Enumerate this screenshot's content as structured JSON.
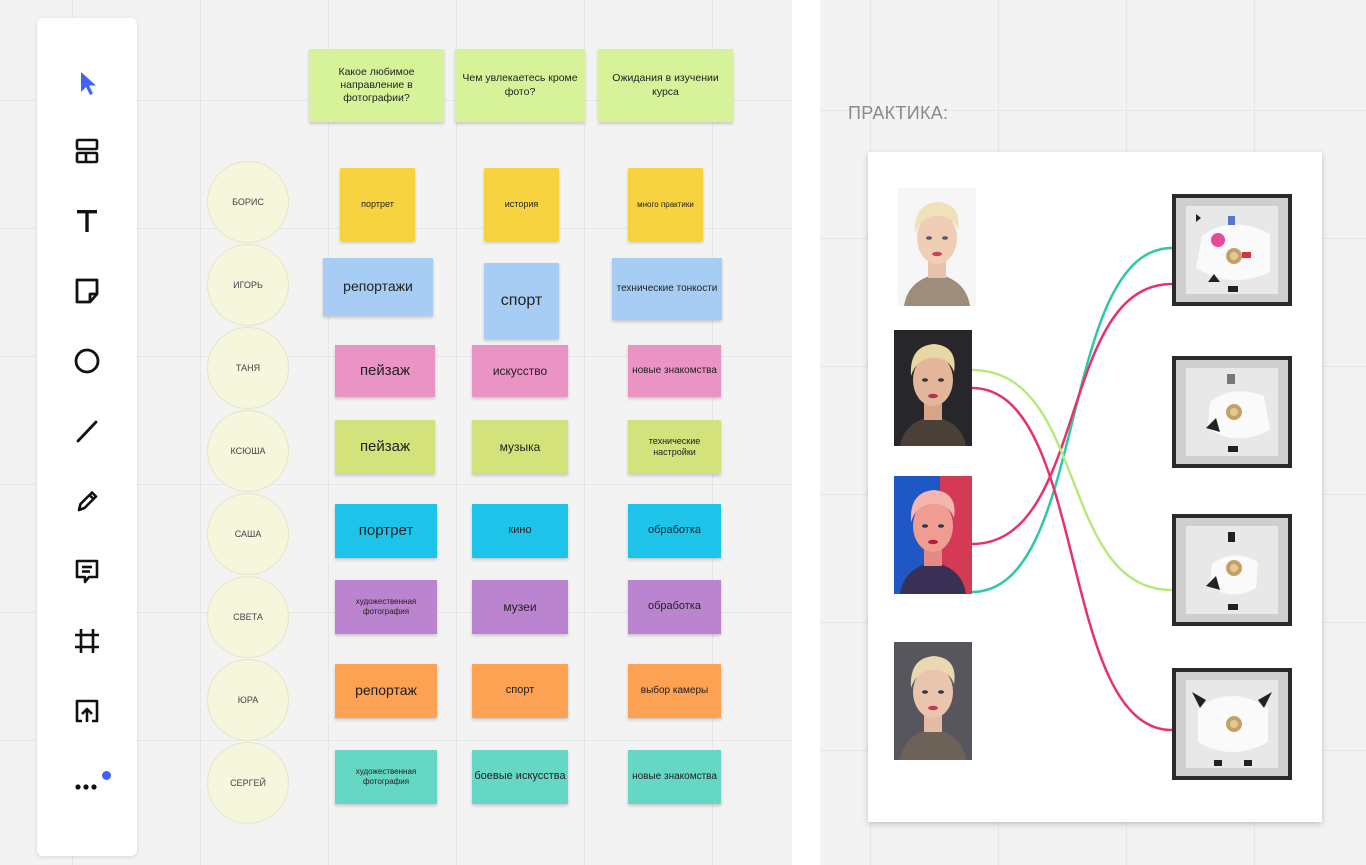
{
  "colors": {
    "yellow": "#f7d43f",
    "blue": "#a7cdf5",
    "pink": "#ea94c6",
    "lime": "#d3e27b",
    "cyan": "#1ec3ea",
    "purple": "#bb84cf",
    "orange": "#fda152",
    "teal": "#66d6c5",
    "header": "#d6f39a",
    "accent": "#4262ff",
    "line_green": "#8fe07c",
    "line_pink": "#e7316f",
    "line_teal": "#2fc7a6",
    "line_lightgreen": "#b7ea7e"
  },
  "toolbar": {
    "tools": [
      "select-cursor-icon",
      "templates-icon",
      "text-icon",
      "sticky-note-icon",
      "shape-circle-icon",
      "line-icon",
      "pen-icon",
      "comment-icon",
      "frame-icon",
      "upload-icon",
      "more-icon"
    ]
  },
  "headers": [
    "Какое любимое направление в фотографии?",
    "Чем увлекаетесь кроме фото?",
    "Ожидания в изучении курса"
  ],
  "participants": [
    "БОРИС",
    "ИГОРЬ",
    "ТАНЯ",
    "КСЮША",
    "САША",
    "СВЕТА",
    "ЮРА",
    "СЕРГЕЙ"
  ],
  "rows": [
    {
      "color": "yellow",
      "cells": [
        "портрет",
        "история",
        "много практики"
      ]
    },
    {
      "color": "blue",
      "cells": [
        "репортажи",
        "спорт",
        "технические тонкости"
      ]
    },
    {
      "color": "pink",
      "cells": [
        "пейзаж",
        "искусство",
        "новые знакомства"
      ]
    },
    {
      "color": "lime",
      "cells": [
        "пейзаж",
        "музыка",
        "технические настройки"
      ]
    },
    {
      "color": "cyan",
      "cells": [
        "портрет",
        "кино",
        "обработка"
      ]
    },
    {
      "color": "purple",
      "cells": [
        "художественная фотография",
        "музеи",
        "обработка"
      ]
    },
    {
      "color": "orange",
      "cells": [
        "репортаж",
        "спорт",
        "выбор камеры"
      ]
    },
    {
      "color": "teal",
      "cells": [
        "художественная фотография",
        "боевые искусства",
        "новые знакомства"
      ]
    }
  ],
  "practice": {
    "title": "ПРАКТИКА:"
  }
}
